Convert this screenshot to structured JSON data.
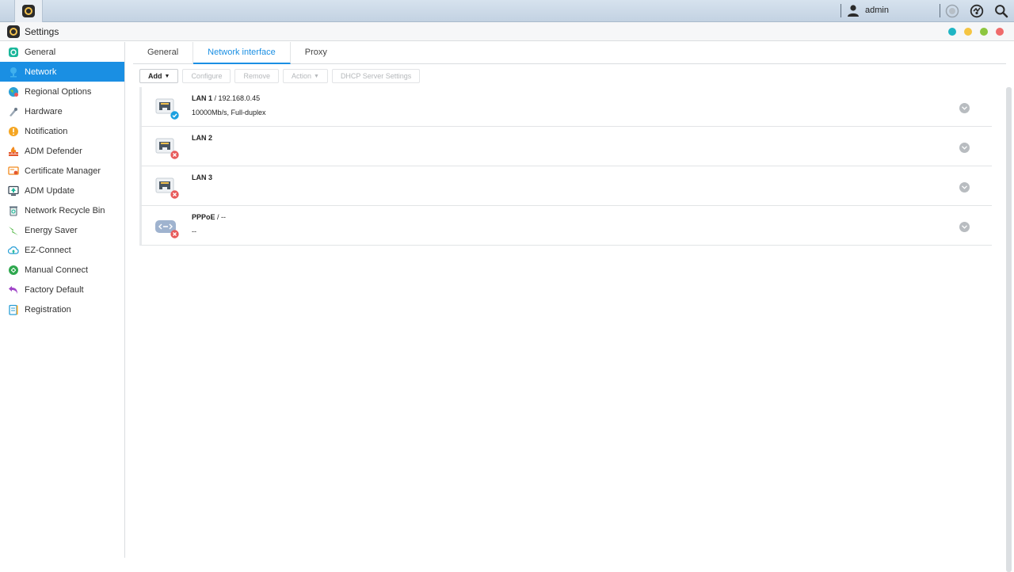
{
  "taskbar": {
    "user_label": "admin"
  },
  "window": {
    "title": "Settings",
    "controls": [
      "restore",
      "minimize",
      "maximize",
      "close"
    ]
  },
  "sidebar": {
    "items": [
      {
        "label": "General",
        "icon": "general-icon"
      },
      {
        "label": "Network",
        "icon": "network-icon",
        "active": true
      },
      {
        "label": "Regional Options",
        "icon": "globe-icon"
      },
      {
        "label": "Hardware",
        "icon": "hardware-icon"
      },
      {
        "label": "Notification",
        "icon": "notification-icon"
      },
      {
        "label": "ADM Defender",
        "icon": "firewall-icon"
      },
      {
        "label": "Certificate Manager",
        "icon": "certificate-icon"
      },
      {
        "label": "ADM Update",
        "icon": "update-icon"
      },
      {
        "label": "Network Recycle Bin",
        "icon": "recycle-bin-icon"
      },
      {
        "label": "Energy Saver",
        "icon": "energy-icon"
      },
      {
        "label": "EZ-Connect",
        "icon": "cloud-icon"
      },
      {
        "label": "Manual Connect",
        "icon": "connect-icon"
      },
      {
        "label": "Factory Default",
        "icon": "undo-icon"
      },
      {
        "label": "Registration",
        "icon": "registration-icon"
      }
    ]
  },
  "tabs": [
    {
      "label": "General"
    },
    {
      "label": "Network interface",
      "active": true
    },
    {
      "label": "Proxy"
    }
  ],
  "toolbar": {
    "add": "Add",
    "configure": "Configure",
    "remove": "Remove",
    "action": "Action",
    "dhcp": "DHCP Server Settings"
  },
  "interfaces": [
    {
      "name": "LAN 1",
      "detail": "/ 192.168.0.45",
      "status_text": "10000Mb/s, Full-duplex",
      "status": "connected",
      "icon": "ethernet-port-icon"
    },
    {
      "name": "LAN 2",
      "detail": "",
      "status_text": "",
      "status": "disconnected",
      "icon": "ethernet-port-icon"
    },
    {
      "name": "LAN 3",
      "detail": "",
      "status_text": "",
      "status": "disconnected",
      "icon": "ethernet-port-icon"
    },
    {
      "name": "PPPoE",
      "detail": "/ --",
      "status_text": "--",
      "status": "disconnected",
      "icon": "pppoe-icon"
    }
  ],
  "colors": {
    "accent": "#1a8fe3",
    "connected": "#1aa0e0",
    "disconnected": "#e85a5a",
    "win_restore": "#1fb5c4",
    "win_minimize": "#f5c542",
    "win_maximize": "#8dc63f",
    "win_close": "#ef6b6b"
  }
}
